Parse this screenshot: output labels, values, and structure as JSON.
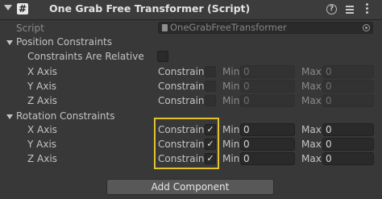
{
  "header": {
    "title": "One Grab Free Transformer (Script)",
    "enabled_mark": "#"
  },
  "script": {
    "label": "Script",
    "value": "OneGrabFreeTransformer"
  },
  "position": {
    "heading": "Position Constraints",
    "relative_label": "Constraints Are Relative",
    "axes": [
      {
        "label": "X Axis",
        "constrain": "Constrain",
        "min_label": "Min",
        "min": "0",
        "max_label": "Max",
        "max": "0"
      },
      {
        "label": "Y Axis",
        "constrain": "Constrain",
        "min_label": "Min",
        "min": "0",
        "max_label": "Max",
        "max": "0"
      },
      {
        "label": "Z Axis",
        "constrain": "Constrain",
        "min_label": "Min",
        "min": "0",
        "max_label": "Max",
        "max": "0"
      }
    ]
  },
  "rotation": {
    "heading": "Rotation Constraints",
    "checkmark": "✓",
    "axes": [
      {
        "label": "X Axis",
        "constrain": "Constrain",
        "min_label": "Min",
        "min": "0",
        "max_label": "Max",
        "max": "0"
      },
      {
        "label": "Y Axis",
        "constrain": "Constrain",
        "min_label": "Min",
        "min": "0",
        "max_label": "Max",
        "max": "0"
      },
      {
        "label": "Z Axis",
        "constrain": "Constrain",
        "min_label": "Min",
        "min": "0",
        "max_label": "Max",
        "max": "0"
      }
    ]
  },
  "add_component": "Add Component",
  "colors": {
    "background": "#383838",
    "highlight": "#e2c32c"
  },
  "icons": [
    "foldout-arrow-icon",
    "help-icon",
    "preset-icon",
    "context-menu-icon",
    "object-picker-icon",
    "script-asset-icon"
  ]
}
